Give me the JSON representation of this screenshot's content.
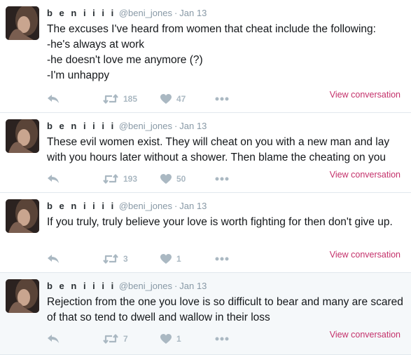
{
  "colors": {
    "accent_link": "#c4306a",
    "muted": "#8899a6",
    "icon": "#aab8c2",
    "border": "#e1e8ed"
  },
  "icons": {
    "reply": "reply-icon",
    "retweet": "retweet-icon",
    "like": "heart-icon",
    "more": "more-icon"
  },
  "tweets": [
    {
      "name": "b e n i i i i",
      "handle": "@beni_jones",
      "separator": "·",
      "time": "Jan 13",
      "text": "The excuses I've heard from women that cheat include the following:\n-he's always at work\n-he doesn't love me anymore (?)\n-I'm unhappy",
      "retweets": "185",
      "likes": "47",
      "view": "View conversation"
    },
    {
      "name": "b e n i i i i",
      "handle": "@beni_jones",
      "separator": "·",
      "time": "Jan 13",
      "text": "These evil women exist. They will cheat on you with a new man and lay with you hours later without a shower.  Then blame the cheating on you",
      "retweets": "193",
      "likes": "50",
      "view": "View conversation"
    },
    {
      "name": "b e n i i i i",
      "handle": "@beni_jones",
      "separator": "·",
      "time": "Jan 13",
      "text": "If you truly, truly believe your love is worth fighting for then don't give up.",
      "retweets": "3",
      "likes": "1",
      "view": "View conversation"
    },
    {
      "name": "b e n i i i i",
      "handle": "@beni_jones",
      "separator": "·",
      "time": "Jan 13",
      "text": "Rejection from the one you love is so difficult to bear and many are scared of that so tend to dwell and wallow in their loss",
      "retweets": "7",
      "likes": "1",
      "view": "View conversation"
    }
  ]
}
